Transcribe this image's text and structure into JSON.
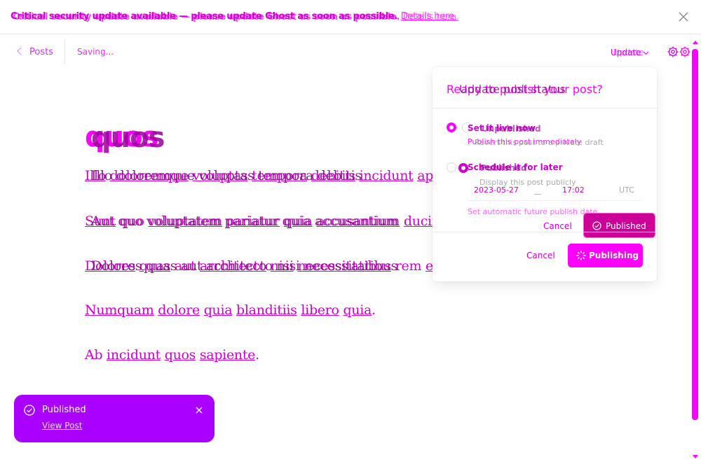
{
  "banner": {
    "message": "Critical security update available — please update Ghost as soon as possible.",
    "link": "Details here.",
    "message_ghost": "Critical security update available — please update Ghost as soon as possible.",
    "link_ghost": "Details here."
  },
  "header": {
    "back_label": "Posts",
    "status": "Saving...",
    "update_label": "Update",
    "update_label_ghost": "Update"
  },
  "post": {
    "title": "quos",
    "title_ghost": "quos",
    "paragraphs": [
      [
        "Illo",
        " ",
        "doloremque",
        " ",
        "voluptas",
        " ",
        "tempora",
        " ",
        "debitis",
        " ",
        "incidunt",
        " ",
        "aperiam"
      ],
      [
        "Sunt",
        " ",
        "quo",
        " ",
        "voluptatem",
        " ",
        "pariatur",
        " ",
        "quia",
        " ",
        "accusantium",
        " ",
        "ducimus"
      ],
      [
        "Dolores",
        " ",
        "quas",
        " ",
        "aut",
        " ",
        "architecto",
        " ",
        "nisi",
        " ",
        "necessitatibus",
        " ",
        "rem",
        " ",
        "excepturi"
      ],
      [
        "Numquam",
        " ",
        "dolore",
        " ",
        "quia",
        " ",
        "blanditiis",
        " ",
        "libero",
        " ",
        "quia",
        "."
      ],
      [
        "Ab",
        " ",
        "incidunt",
        " ",
        "quos",
        " ",
        "sapiente",
        "."
      ]
    ],
    "paragraphs_ghost": [
      "Illo doloremque voluptas tempora debitis",
      "Aut quo voluptatem pariatur quia accusantium",
      "Dolores quas aut architecto nisi necessitatibus"
    ]
  },
  "popover": {
    "title": "Ready to publish your post?",
    "title_ghost": "Update post status",
    "option1_label": "Set it live now",
    "option1_label_ghost": "Unpublished",
    "option1_sub": "Publish this post immediately",
    "option1_sub_ghost": "Revert this post to a private draft",
    "option2_label": "Schedule it for later",
    "option2_label_ghost": "Published",
    "option2_sub_ghost": "Display this post publicly",
    "date": "2023-05-27",
    "time": "17:02",
    "tz": "UTC",
    "option2_sub": "Set automatic future publish date",
    "cancel_small": "Cancel",
    "published_btn": "Published",
    "cancel": "Cancel",
    "publishing_btn": "Publishing"
  },
  "toast": {
    "title": "Published",
    "link": "View Post"
  },
  "colors": {
    "accent": "#ff00ff",
    "toast_bg": "#aa00ff",
    "published_btn_bg": "#cc0099"
  }
}
